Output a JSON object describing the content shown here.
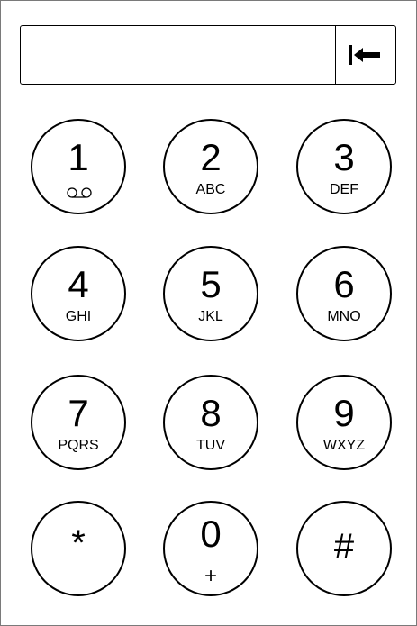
{
  "display": {
    "value": "",
    "backspace_icon": "backspace-arrow-icon"
  },
  "keys": [
    {
      "digit": "1",
      "sub": "",
      "icon": "voicemail-icon"
    },
    {
      "digit": "2",
      "sub": "ABC"
    },
    {
      "digit": "3",
      "sub": "DEF"
    },
    {
      "digit": "4",
      "sub": "GHI"
    },
    {
      "digit": "5",
      "sub": "JKL"
    },
    {
      "digit": "6",
      "sub": "MNO"
    },
    {
      "digit": "7",
      "sub": "PQRS"
    },
    {
      "digit": "8",
      "sub": "TUV"
    },
    {
      "digit": "9",
      "sub": "WXYZ"
    },
    {
      "digit": "*",
      "sub": ""
    },
    {
      "digit": "0",
      "sub": "+"
    },
    {
      "digit": "#",
      "sub": ""
    }
  ]
}
